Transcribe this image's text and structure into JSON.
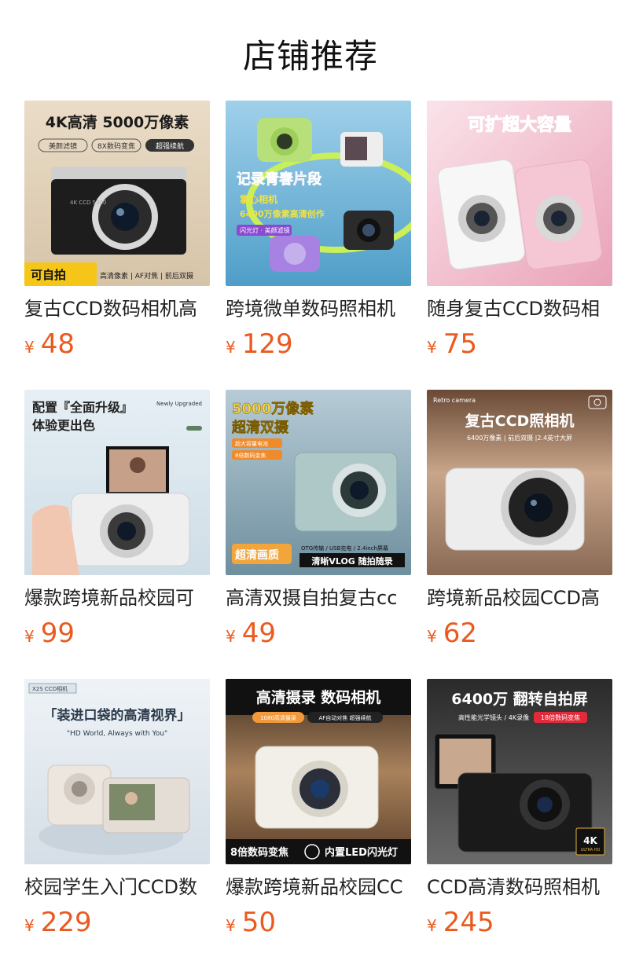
{
  "header": {
    "title": "店铺推荐"
  },
  "currency": "¥",
  "products": [
    {
      "title": "复古CCD数码相机高",
      "price": "48",
      "image": {
        "headline": "4K高清 5000万像素",
        "chips": [
          "美颜滤镜",
          "8X数码变焦",
          "超强续航"
        ],
        "badge": "可自拍",
        "features": "高清像素 | AF对焦 | 前后双摄",
        "camera_text": "4K CCD 5000"
      }
    },
    {
      "title": "跨境微单数码照相机",
      "price": "129",
      "image": {
        "headline": "记录青春片段",
        "sub1": "掌心相机",
        "sub2": "6400万像素高清创作",
        "chip": "闪光灯 · 美颜滤镜"
      }
    },
    {
      "title": "随身复古CCD数码相",
      "price": "75",
      "image": {
        "headline": "可扩超大容量"
      }
    },
    {
      "title": "爆款跨境新品校园可",
      "price": "99",
      "image": {
        "headline1": "配置『全面升级』",
        "headline2": "体验更出色",
        "corner": "Newly Upgraded"
      }
    },
    {
      "title": "高清双摄自拍复古cc",
      "price": "49",
      "image": {
        "headline1": "5000万像素",
        "headline2": "超清双摄",
        "chip1": "超大容量电池",
        "chip2": "8倍数码变焦",
        "badge": "超清画质",
        "specs": "OTG传输 / USB充电 / 2.4inch屏幕",
        "slogan": "清晰VLOG 随拍随录"
      }
    },
    {
      "title": "跨境新品校园CCD高",
      "price": "62",
      "image": {
        "corner": "Retro camera",
        "headline": "复古CCD照相机",
        "sub": "6400万像素 | 前后双摄 |2.4英寸大屏"
      }
    },
    {
      "title": "校园学生入门CCD数",
      "price": "229",
      "image": {
        "tag": "X2S CCD相机",
        "headline": "「装进口袋的高清视界」",
        "sub": "\"HD World, Always with You\""
      }
    },
    {
      "title": "爆款跨境新品校园CC",
      "price": "50",
      "image": {
        "headline": "高清摄录 数码相机",
        "chip1": "1080高清摄录",
        "chip2": "AF自动对焦 超强续航",
        "bottom1": "8倍数码变焦",
        "bottom2": "内置LED闪光灯"
      }
    },
    {
      "title": "CCD高清数码照相机",
      "price": "245",
      "image": {
        "headline": "6400万 翻转自拍屏",
        "sub": "高性能光学镜头 / 4K录像",
        "chip": "18倍数码变焦",
        "badge1": "4K",
        "badge2": "ULTRA HD"
      }
    }
  ],
  "colors": {
    "price": "#ea5a1e",
    "title": "#222222"
  }
}
